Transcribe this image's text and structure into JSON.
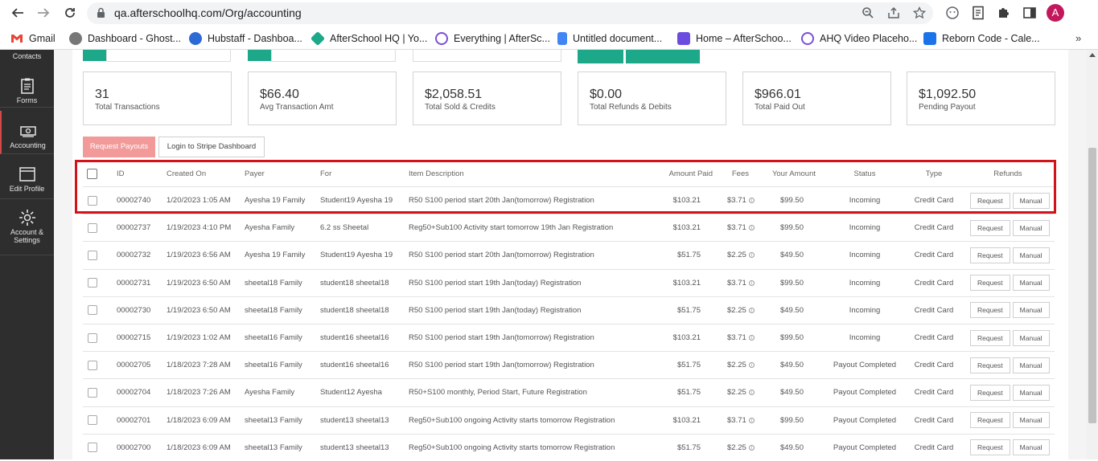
{
  "browser": {
    "url": "qa.afterschoolhq.com/Org/accounting",
    "avatar_letter": "A",
    "bookmarks": [
      {
        "label": "Gmail",
        "color": "#ea4335"
      },
      {
        "label": "Dashboard - Ghost...",
        "color": "#777777"
      },
      {
        "label": "Hubstaff - Dashboa...",
        "color": "#2c6bd6"
      },
      {
        "label": "AfterSchool HQ | Yo...",
        "color": "#1ea88a"
      },
      {
        "label": "Everything | AfterSc...",
        "color": "#7b4fd6"
      },
      {
        "label": "Untitled document...",
        "color": "#4285f4"
      },
      {
        "label": "Home – AfterSchoo...",
        "color": "#6c4ce0"
      },
      {
        "label": "AHQ Video Placeho...",
        "color": "#7b4fd6"
      },
      {
        "label": "Reborn Code - Cale...",
        "color": "#1a73e8"
      }
    ],
    "bookmarks_more": "»"
  },
  "sidebar": {
    "contacts_label": "Contacts",
    "items": [
      {
        "label": "Forms",
        "icon": "clipboard-icon"
      },
      {
        "label": "Accounting",
        "icon": "cash-icon"
      },
      {
        "label": "Edit Profile",
        "icon": "window-icon"
      },
      {
        "label": "Account &\nSettings",
        "icon": "gear-icon"
      }
    ]
  },
  "stats": [
    {
      "value": "31",
      "label": "Total Transactions"
    },
    {
      "value": "$66.40",
      "label": "Avg Transaction Amt"
    },
    {
      "value": "$2,058.51",
      "label": "Total Sold & Credits"
    },
    {
      "value": "$0.00",
      "label": "Total Refunds & Debits"
    },
    {
      "value": "$966.01",
      "label": "Total Paid Out"
    },
    {
      "value": "$1,092.50",
      "label": "Pending Payout"
    }
  ],
  "actions": {
    "request_payouts": "Request Payouts",
    "login_stripe": "Login to Stripe Dashboard"
  },
  "table": {
    "headers": {
      "id": "ID",
      "created": "Created On",
      "payer": "Payer",
      "for": "For",
      "item": "Item Description",
      "amount": "Amount Paid",
      "fees": "Fees",
      "your_amount": "Your Amount",
      "status": "Status",
      "type": "Type",
      "refunds": "Refunds"
    },
    "refund_request": "Request",
    "refund_manual": "Manual",
    "rows": [
      {
        "id": "00002740",
        "created": "1/20/2023 1:05 AM",
        "payer": "Ayesha 19 Family",
        "for": "Student19 Ayesha 19",
        "item": "R50 S100 period start 20th Jan(tomorrow) Registration",
        "amount": "$103.21",
        "fees": "$3.71",
        "your_amount": "$99.50",
        "status": "Incoming",
        "type": "Credit Card"
      },
      {
        "id": "00002737",
        "created": "1/19/2023 4:10 PM",
        "payer": "Ayesha Family",
        "for": "6.2 ss Sheetal",
        "item": "Reg50+Sub100 Activity start tomorrow 19th Jan Registration",
        "amount": "$103.21",
        "fees": "$3.71",
        "your_amount": "$99.50",
        "status": "Incoming",
        "type": "Credit Card"
      },
      {
        "id": "00002732",
        "created": "1/19/2023 6:56 AM",
        "payer": "Ayesha 19 Family",
        "for": "Student19 Ayesha 19",
        "item": "R50 S100 period start 20th Jan(tomorrow) Registration",
        "amount": "$51.75",
        "fees": "$2.25",
        "your_amount": "$49.50",
        "status": "Incoming",
        "type": "Credit Card"
      },
      {
        "id": "00002731",
        "created": "1/19/2023 6:50 AM",
        "payer": "sheetal18 Family",
        "for": "student18 sheetal18",
        "item": "R50 S100 period start 19th Jan(today) Registration",
        "amount": "$103.21",
        "fees": "$3.71",
        "your_amount": "$99.50",
        "status": "Incoming",
        "type": "Credit Card"
      },
      {
        "id": "00002730",
        "created": "1/19/2023 6:50 AM",
        "payer": "sheetal18 Family",
        "for": "student18 sheetal18",
        "item": "R50 S100 period start 19th Jan(today) Registration",
        "amount": "$51.75",
        "fees": "$2.25",
        "your_amount": "$49.50",
        "status": "Incoming",
        "type": "Credit Card"
      },
      {
        "id": "00002715",
        "created": "1/19/2023 1:02 AM",
        "payer": "sheetal16 Family",
        "for": "student16 sheetal16",
        "item": "R50 S100 period start 19th Jan(tomorrow) Registration",
        "amount": "$103.21",
        "fees": "$3.71",
        "your_amount": "$99.50",
        "status": "Incoming",
        "type": "Credit Card"
      },
      {
        "id": "00002705",
        "created": "1/18/2023 7:28 AM",
        "payer": "sheetal16 Family",
        "for": "student16 sheetal16",
        "item": "R50 S100 period start 19th Jan(tomorrow) Registration",
        "amount": "$51.75",
        "fees": "$2.25",
        "your_amount": "$49.50",
        "status": "Payout Completed",
        "type": "Credit Card"
      },
      {
        "id": "00002704",
        "created": "1/18/2023 7:26 AM",
        "payer": "Ayesha Family",
        "for": "Student12 Ayesha",
        "item": "R50+S100 monthly, Period Start, Future Registration",
        "amount": "$51.75",
        "fees": "$2.25",
        "your_amount": "$49.50",
        "status": "Payout Completed",
        "type": "Credit Card"
      },
      {
        "id": "00002701",
        "created": "1/18/2023 6:09 AM",
        "payer": "sheetal13 Family",
        "for": "student13 sheetal13",
        "item": "Reg50+Sub100 ongoing Activity starts tomorrow Registration",
        "amount": "$103.21",
        "fees": "$3.71",
        "your_amount": "$99.50",
        "status": "Payout Completed",
        "type": "Credit Card"
      },
      {
        "id": "00002700",
        "created": "1/18/2023 6:09 AM",
        "payer": "sheetal13 Family",
        "for": "student13 sheetal13",
        "item": "Reg50+Sub100 ongoing Activity starts tomorrow Registration",
        "amount": "$51.75",
        "fees": "$2.25",
        "your_amount": "$49.50",
        "status": "Payout Completed",
        "type": "Credit Card"
      }
    ]
  }
}
